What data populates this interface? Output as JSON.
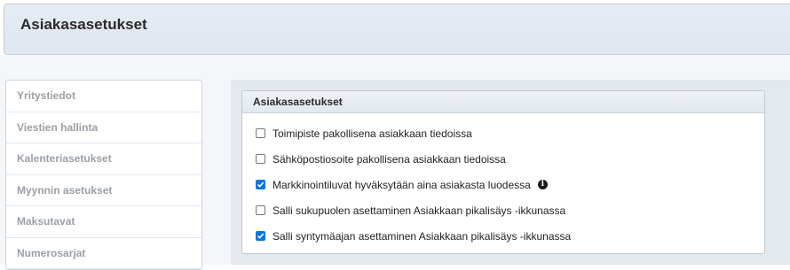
{
  "header": {
    "title": "Asiakasasetukset"
  },
  "sidebar": {
    "items": [
      {
        "label": "Yritystiedot"
      },
      {
        "label": "Viestien hallinta"
      },
      {
        "label": "Kalenteriasetukset"
      },
      {
        "label": "Myynnin asetukset"
      },
      {
        "label": "Maksutavat"
      },
      {
        "label": "Numerosarjat"
      }
    ]
  },
  "panel": {
    "title": "Asiakasasetukset",
    "options": [
      {
        "label": "Toimipiste pakollisena asiakkaan tiedoissa",
        "checked": false
      },
      {
        "label": "Sähköpostiosoite pakollisena asiakkaan tiedoissa",
        "checked": false
      },
      {
        "label": "Markkinointiluvat hyväksytään aina asiakasta luodessa",
        "checked": true,
        "info_icon": "info-icon"
      },
      {
        "label": "Salli sukupuolen asettaminen Asiakkaan pikalisäys -ikkunassa",
        "checked": false
      },
      {
        "label": "Salli syntymäajan asettaminen Asiakkaan pikalisäys -ikkunassa",
        "checked": true
      }
    ]
  },
  "colors": {
    "checkbox_checked": "#0b75e5",
    "header_bg": "#e3e9f1"
  }
}
